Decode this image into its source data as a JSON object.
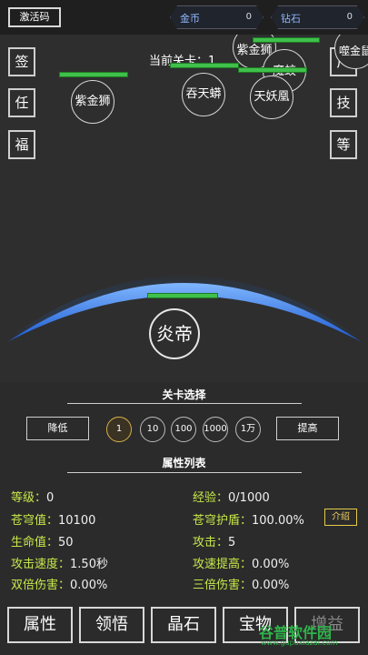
{
  "topbar": {
    "activate_label": "激活码",
    "gold": {
      "label": "金币",
      "value": "0"
    },
    "diamond": {
      "label": "钻石",
      "value": "0"
    }
  },
  "battle": {
    "level_text": "当前关卡：1",
    "left_buttons": [
      "签",
      "任",
      "福"
    ],
    "right_buttons": [
      "广",
      "技",
      "等"
    ],
    "enemies": [
      "紫金狮",
      "吞天蟒",
      "天妖凰",
      "魔蛟",
      "紫金狮",
      "噬金鼠"
    ],
    "hero": "炎帝"
  },
  "stage_select": {
    "title": "关卡选择",
    "decrease_label": "降低",
    "increase_label": "提高",
    "multipliers": [
      "1",
      "10",
      "100",
      "1000",
      "1万"
    ]
  },
  "attributes": {
    "title": "属性列表",
    "left": [
      {
        "label": "等级：",
        "value": "0"
      },
      {
        "label": "苍穹值：",
        "value": "10100"
      },
      {
        "label": "生命值：",
        "value": "50"
      },
      {
        "label": "攻击速度：",
        "value": "1.50秒"
      },
      {
        "label": "双倍伤害：",
        "value": "0.00%"
      }
    ],
    "right": [
      {
        "label": "经验：",
        "value": "0/1000"
      },
      {
        "label": "苍穹护盾：",
        "value": "100.00%"
      },
      {
        "label": "攻击：",
        "value": "5"
      },
      {
        "label": "攻速提高：",
        "value": "0.00%"
      },
      {
        "label": "三倍伤害：",
        "value": "0.00%"
      }
    ],
    "intro_label": "介绍"
  },
  "bottom_nav": [
    "属性",
    "领悟",
    "晶石",
    "宝物",
    "增益"
  ],
  "watermark": {
    "title": "谷普软件园",
    "url": "www.gupuxiazai.com"
  },
  "colors": {
    "accent_green": "#3fc04a",
    "label_yellow": "#c7e84a",
    "arc_blue": "#1e6fe0"
  }
}
